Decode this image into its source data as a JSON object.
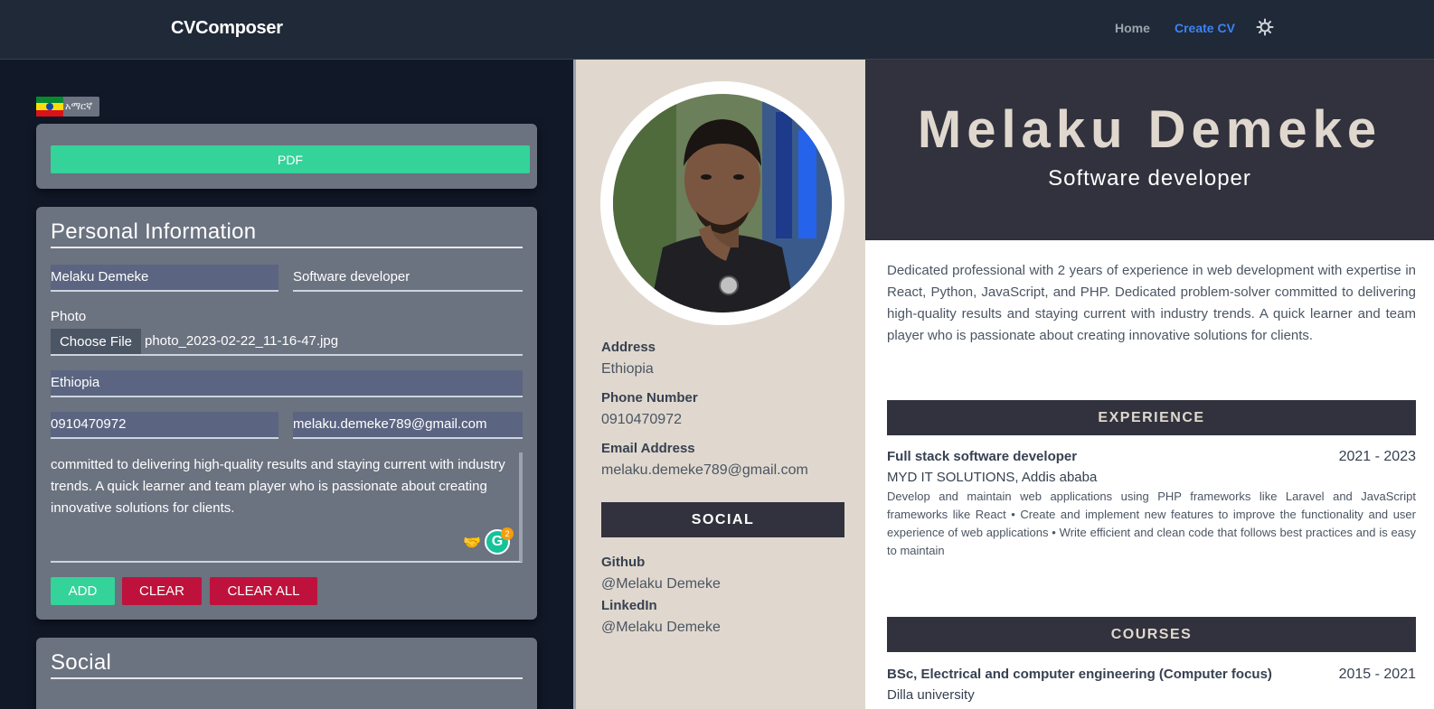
{
  "navbar": {
    "brand": "CVComposer",
    "links": [
      {
        "label": "Home",
        "active": false
      },
      {
        "label": "Create CV",
        "active": true
      }
    ],
    "theme_icon": "gear-icon"
  },
  "colors": {
    "navbar_bg": "#1f2937",
    "page_bg": "#111827",
    "card_bg": "#6b7280",
    "accent_green": "#34d399",
    "danger_red": "#be123c",
    "link_active": "#3b82f6",
    "cv_dark": "#31323d",
    "cv_beige": "#e0d8ce"
  },
  "editor": {
    "language": {
      "label": "አማርኛ",
      "flag_icon": "ethiopia-flag-icon"
    },
    "pdf_button": "PDF",
    "personal": {
      "title": "Personal Information",
      "name_value": "Melaku Demeke",
      "job_title_value": "Software developer",
      "photo_label": "Photo",
      "choose_file_label": "Choose File",
      "file_name": "photo_2023-02-22_11-16-47.jpg",
      "address_value": "Ethiopia",
      "phone_value": "0910470972",
      "email_value": "melaku.demeke789@gmail.com",
      "summary_visible": "committed to delivering high-quality results and staying current with industry\ntrends. A quick learner and team player who is passionate about creating innovative solutions for clients.",
      "grammarly_count": "2",
      "buttons": {
        "add": "ADD",
        "clear": "CLEAR",
        "clear_all": "CLEAR ALL"
      }
    },
    "social": {
      "title": "Social"
    }
  },
  "cv": {
    "name": "Melaku Demeke",
    "role": "Software developer",
    "summary": "Dedicated professional with 2 years of experience in web development with expertise in React, Python, JavaScript, and PHP. Dedicated problem-solver committed to delivering high-quality results and staying current with industry trends. A quick learner and team player who is passionate about creating innovative solutions for clients.",
    "contact": {
      "address_label": "Address",
      "address_value": "Ethiopia",
      "phone_label": "Phone Number",
      "phone_value": "0910470972",
      "email_label": "Email Address",
      "email_value": "melaku.demeke789@gmail.com"
    },
    "social_heading": "SOCIAL",
    "social": [
      {
        "label": "Github",
        "value": "@Melaku Demeke"
      },
      {
        "label": "LinkedIn",
        "value": "@Melaku Demeke"
      }
    ],
    "experience_heading": "EXPERIENCE",
    "experience": [
      {
        "title": "Full stack software developer",
        "dates": "2021 - 2023",
        "company": "MYD IT SOLUTIONS, Addis ababa",
        "description": "Develop and maintain web applications using PHP frameworks like Laravel and JavaScript frameworks like React • Create and implement new features to improve the functionality and user experience of web applications • Write efficient and clean code that follows best practices and is easy to maintain"
      }
    ],
    "courses_heading": "COURSES",
    "courses": [
      {
        "title": "BSc, Electrical and computer engineering (Computer focus)",
        "dates": "2015 - 2021",
        "institution": "Dilla university"
      }
    ]
  }
}
